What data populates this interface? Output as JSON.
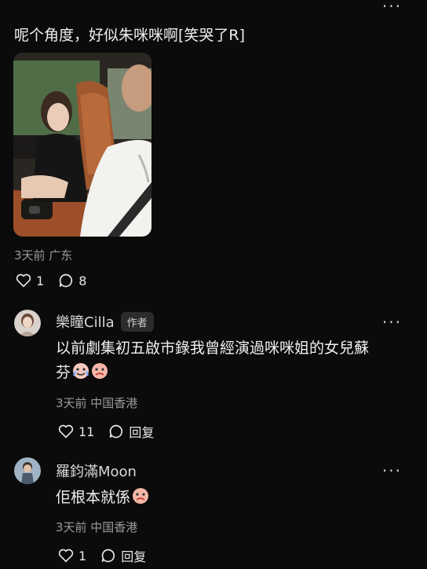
{
  "post": {
    "text": "呢个角度，好似朱咪咪啊[笑哭了R]",
    "meta": "3天前 广东",
    "likes": "1",
    "comments": "8"
  },
  "comments": [
    {
      "username": "樂瞳Cilla",
      "badge": "作者",
      "text_line1": "以前劇集初五啟市錄我曾經演過咪咪姐的女兒蘇",
      "text_line2": "芬",
      "meta": "3天前 中国香港",
      "likes": "11",
      "reply_label": "回复"
    },
    {
      "username": "羅鈞滿Moon",
      "text_line1": "佢根本就係",
      "meta": "3天前 中国香港",
      "likes": "1",
      "reply_label": "回复"
    }
  ],
  "more_label": "···",
  "colors": {
    "background": "#0b0b0b",
    "secondary_text": "#9a9a9a"
  }
}
